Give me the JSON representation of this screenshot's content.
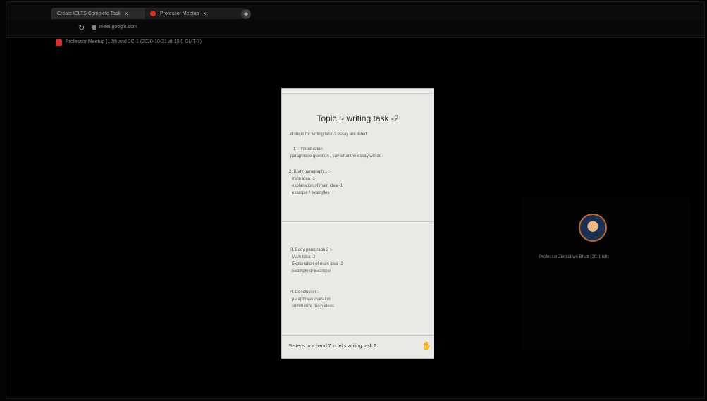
{
  "browser": {
    "tabs": [
      {
        "label": "Create IELTS Complete Task"
      },
      {
        "label": "Professor Meetup"
      }
    ],
    "url": "meet.google.com"
  },
  "meeting": {
    "title": "Professor Meetup (12th and 2C-1 (2020-10-21 at 19:0 GMT-7)"
  },
  "document": {
    "title": "Topic :- writing task -2",
    "lines": [
      "4 steps for writing task-2 essay are listed:",
      "1 :- Introduction",
      "paraphrase question / say what the essay will do",
      "2. Body paragraph 1 :-",
      "main idea -1",
      "explanation of main idea -1",
      "example / examples",
      "3. Body paragraph 2 :-",
      "Main Idea -2",
      "Explanation of main idea -2",
      "Example or Example",
      "4. Conclusion :-",
      "paraphrase question",
      "summarize main ideas"
    ],
    "caption": "5 steps to a band 7 in ielts writing task 2"
  },
  "participant": {
    "name": "Professor Zimbabwe Bhatt (2C-1 ielt)"
  },
  "colors": {
    "background": "#000000",
    "record_red": "#d93025",
    "doc_bg": "#e9e9e6"
  },
  "icons": [
    "reload-icon",
    "lock-icon",
    "meet-recording-icon",
    "new-tab-icon",
    "raise-hand-icon",
    "close-icon"
  ]
}
